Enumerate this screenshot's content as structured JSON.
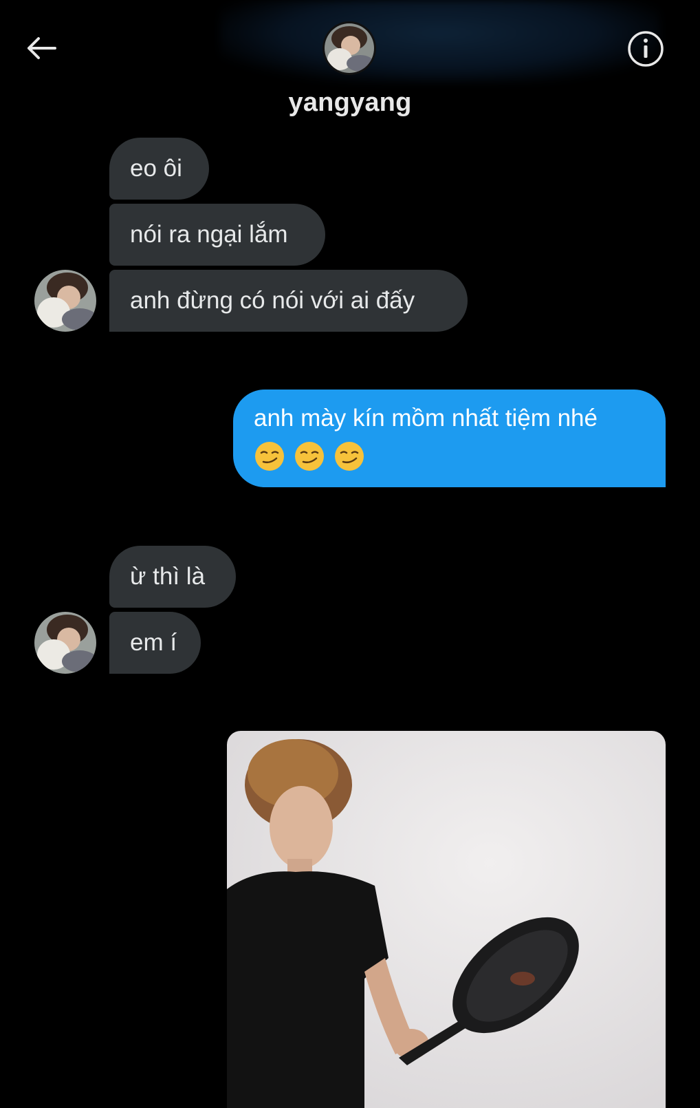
{
  "header": {
    "contact_name": "yangyang",
    "back_icon": "arrow-left-icon",
    "info_icon": "info-circle-icon"
  },
  "conversation": {
    "received_group_1": [
      "eo ôi",
      "nói ra ngại lắm",
      "anh đừng có nói với ai đấy"
    ],
    "sent_message": {
      "text": "anh mày kín mồm nhất tiệm nhé",
      "emojis": [
        "😏",
        "😏",
        "😏"
      ]
    },
    "received_group_2": [
      "ừ thì là",
      "em í"
    ]
  },
  "colors": {
    "background": "#000000",
    "received_bubble": "#2f3336",
    "sent_bubble": "#1d9bf0",
    "text": "#e7e9ea"
  }
}
